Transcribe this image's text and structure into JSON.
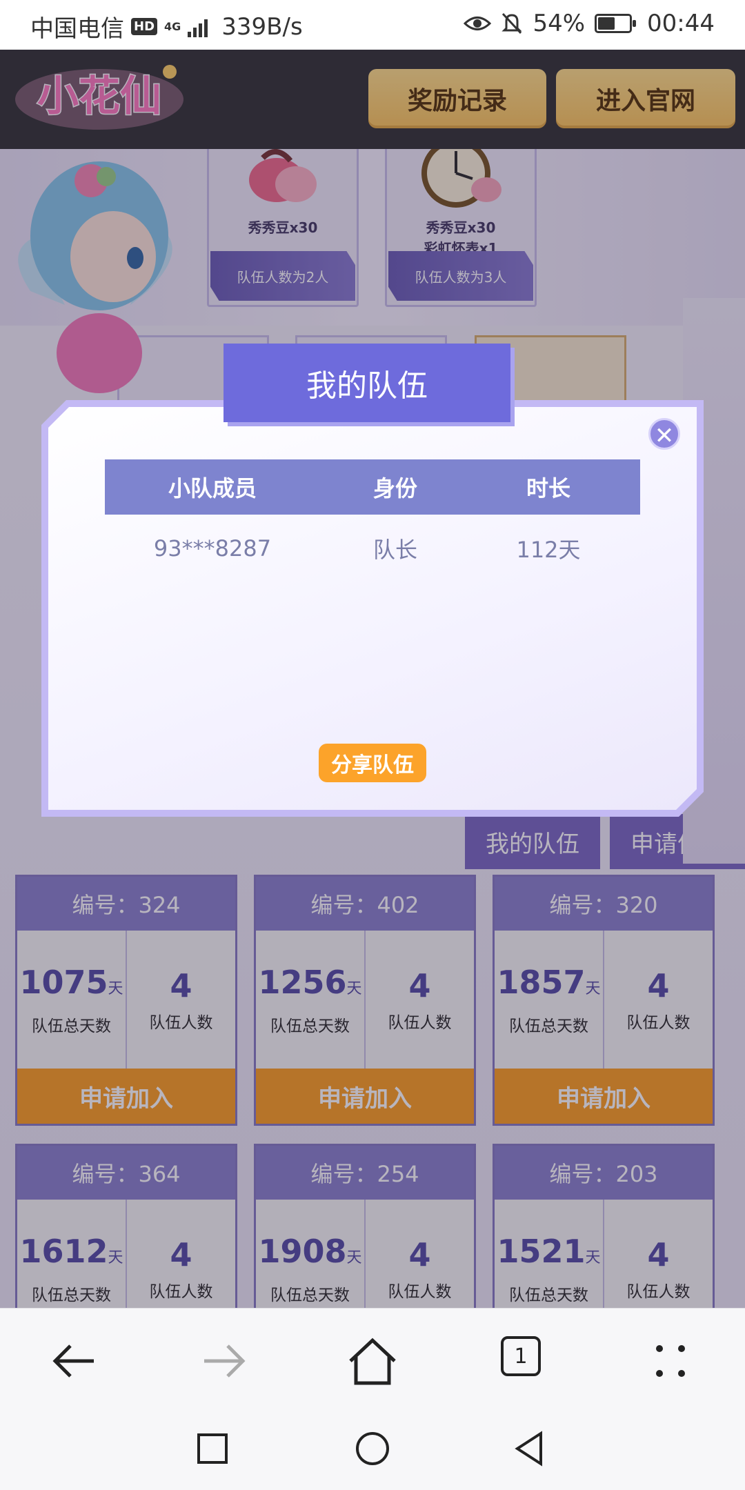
{
  "status_bar": {
    "carrier": "中国电信",
    "hd": "HD",
    "network": "4G",
    "speed": "339B/s",
    "battery": "54%",
    "battery_level": 0.54,
    "time": "00:44"
  },
  "header": {
    "logo_text": "小花仙",
    "buttons": [
      "奖励记录",
      "进入官网"
    ]
  },
  "prizes": [
    {
      "items": [
        "秀秀豆x30"
      ],
      "requirement": "队伍人数为2人"
    },
    {
      "items": [
        "秀秀豆x30",
        "彩虹怀表x1"
      ],
      "requirement": "队伍人数为3人"
    }
  ],
  "modal": {
    "title": "我的队伍",
    "columns": [
      "小队成员",
      "身份",
      "时长"
    ],
    "rows": [
      {
        "member": "93***8287",
        "role": "队长",
        "duration": "112天"
      }
    ],
    "share_button": "分享队伍"
  },
  "team_tabs": [
    "我的队伍",
    "申请信息"
  ],
  "teams": [
    {
      "id_label": "编号：324",
      "days": "1075",
      "days_unit": "天",
      "days_label": "队伍总天数",
      "members": "4",
      "members_label": "队伍人数",
      "button": "申请加入"
    },
    {
      "id_label": "编号：402",
      "days": "1256",
      "days_unit": "天",
      "days_label": "队伍总天数",
      "members": "4",
      "members_label": "队伍人数",
      "button": "申请加入"
    },
    {
      "id_label": "编号：320",
      "days": "1857",
      "days_unit": "天",
      "days_label": "队伍总天数",
      "members": "4",
      "members_label": "队伍人数",
      "button": "申请加入"
    },
    {
      "id_label": "编号：364",
      "days": "1612",
      "days_unit": "天",
      "days_label": "队伍总天数",
      "members": "4",
      "members_label": "队伍人数",
      "button": "申请加入"
    },
    {
      "id_label": "编号：254",
      "days": "1908",
      "days_unit": "天",
      "days_label": "队伍总天数",
      "members": "4",
      "members_label": "队伍人数",
      "button": "申请加入"
    },
    {
      "id_label": "编号：203",
      "days": "1521",
      "days_unit": "天",
      "days_label": "队伍总天数",
      "members": "4",
      "members_label": "队伍人数",
      "button": "申请加入"
    }
  ],
  "browser": {
    "tab_count": "1",
    "icons": [
      "back-arrow-icon",
      "forward-arrow-icon",
      "home-icon",
      "tabs-icon",
      "menu-dots-icon"
    ]
  },
  "system_nav": {
    "icons": [
      "recents-square-icon",
      "home-circle-icon",
      "back-triangle-icon"
    ]
  }
}
